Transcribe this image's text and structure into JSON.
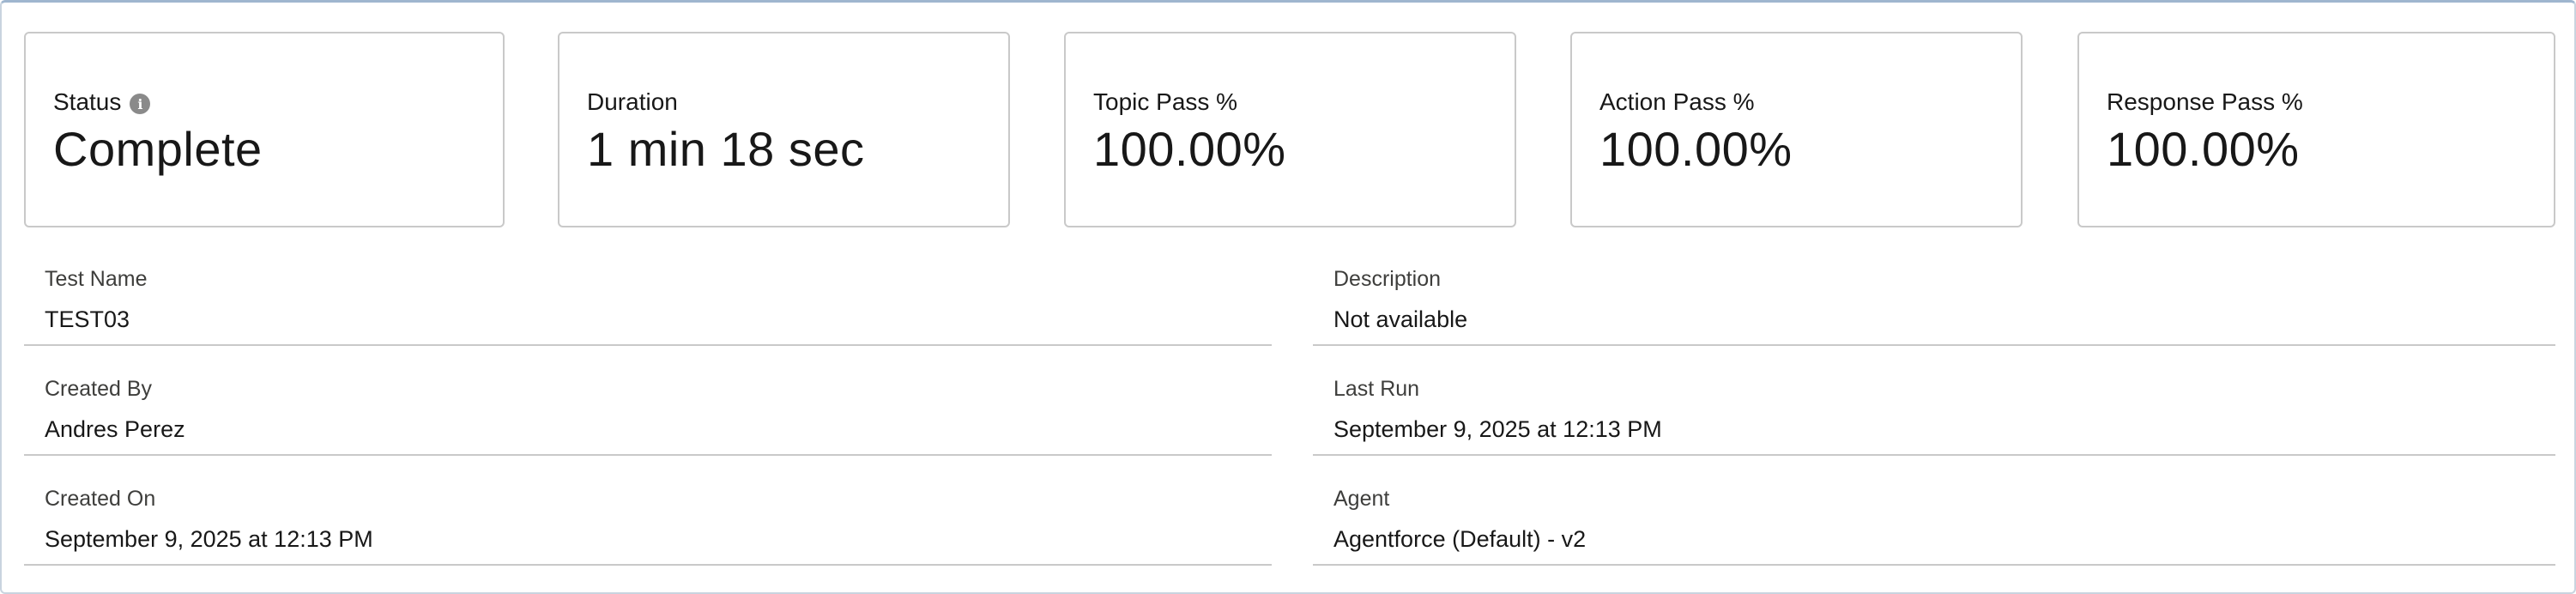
{
  "summary_cards": [
    {
      "label": "Status",
      "value": "Complete",
      "icon": "info-icon"
    },
    {
      "label": "Duration",
      "value": "1 min 18 sec"
    },
    {
      "label": "Topic Pass %",
      "value": "100.00%"
    },
    {
      "label": "Action Pass %",
      "value": "100.00%"
    },
    {
      "label": "Response Pass %",
      "value": "100.00%"
    }
  ],
  "details": {
    "test_name": {
      "label": "Test Name",
      "value": "TEST03"
    },
    "description": {
      "label": "Description",
      "value": "Not available"
    },
    "created_by": {
      "label": "Created By",
      "value": "Andres Perez"
    },
    "last_run": {
      "label": "Last Run",
      "value": "September 9, 2025 at 12:13 PM"
    },
    "created_on": {
      "label": "Created On",
      "value": "September 9, 2025 at 12:13 PM"
    },
    "agent": {
      "label": "Agent",
      "value": "Agentforce (Default) - v2"
    }
  },
  "colors": {
    "border": "#c9c9c9",
    "text": "#181818",
    "label_text": "#3e3e3c",
    "info_icon": "#8a8a8a"
  }
}
